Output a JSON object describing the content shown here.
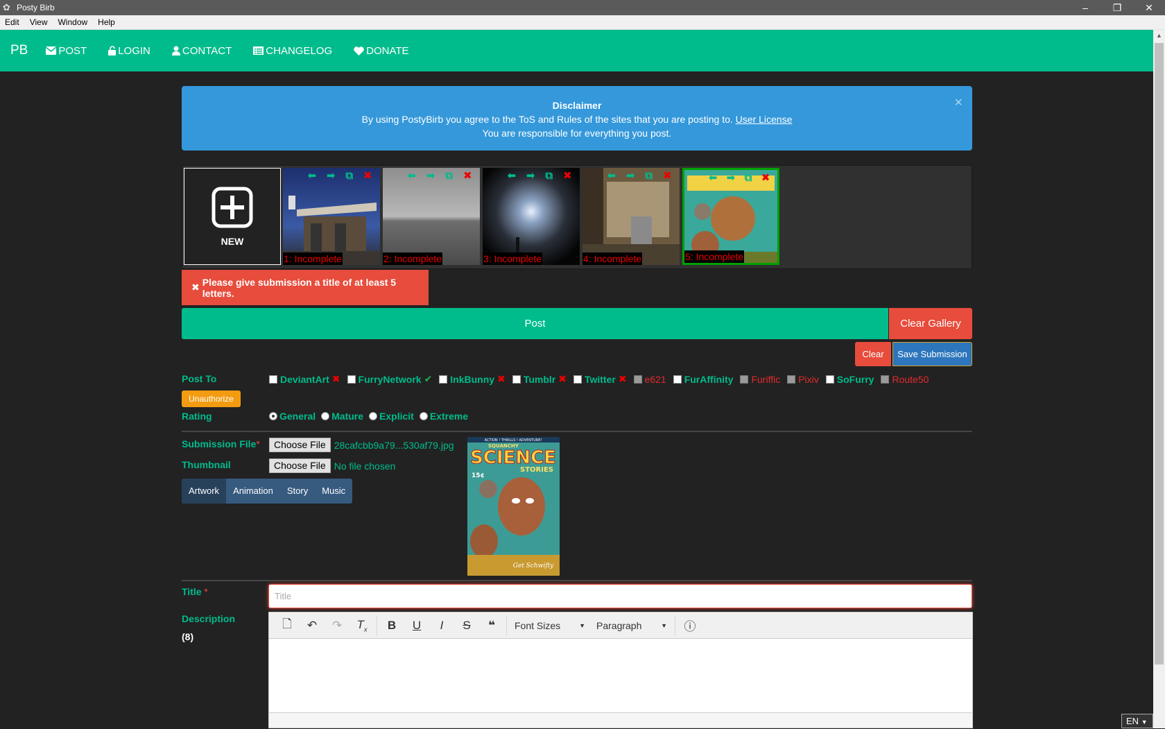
{
  "window": {
    "title": "Posty Birb",
    "menu": [
      "Edit",
      "View",
      "Window",
      "Help"
    ]
  },
  "nav": {
    "brand": "PB",
    "items": [
      {
        "label": "POST",
        "icon": "envelope-icon"
      },
      {
        "label": "LOGIN",
        "icon": "unlock-icon"
      },
      {
        "label": "CONTACT",
        "icon": "user-icon"
      },
      {
        "label": "CHANGELOG",
        "icon": "list-icon"
      },
      {
        "label": "DONATE",
        "icon": "heart-icon"
      }
    ]
  },
  "disclaimer": {
    "title": "Disclaimer",
    "line1": "By using PostyBirb you agree to the ToS and Rules of the sites that you are posting to.",
    "link": "User License",
    "line2": "You are responsible for everything you post.",
    "close": "×"
  },
  "gallery": {
    "new_label": "NEW",
    "items": [
      {
        "status": "1: Incomplete"
      },
      {
        "status": "2: Incomplete"
      },
      {
        "status": "3: Incomplete"
      },
      {
        "status": "4: Incomplete"
      },
      {
        "status": "5: Incomplete"
      }
    ]
  },
  "alert": {
    "icon": "✖",
    "text": "Please give submission a title of at least 5 letters."
  },
  "actions": {
    "post": "Post",
    "clear_gallery": "Clear Gallery",
    "clear": "Clear",
    "save": "Save Submission"
  },
  "post_to": {
    "label": "Post To",
    "unauthorize": "Unauthorize",
    "sites": [
      {
        "name": "DeviantArt",
        "state": "x"
      },
      {
        "name": "FurryNetwork",
        "state": "check"
      },
      {
        "name": "InkBunny",
        "state": "x"
      },
      {
        "name": "Tumblr",
        "state": "x"
      },
      {
        "name": "Twitter",
        "state": "x"
      },
      {
        "name": "e621",
        "state": "disabled"
      },
      {
        "name": "FurAffinity",
        "state": "ok"
      },
      {
        "name": "Furiffic",
        "state": "disabled"
      },
      {
        "name": "Pixiv",
        "state": "disabled"
      },
      {
        "name": "SoFurry",
        "state": "ok"
      },
      {
        "name": "Route50",
        "state": "disabled"
      }
    ]
  },
  "rating": {
    "label": "Rating",
    "options": [
      "General",
      "Mature",
      "Explicit",
      "Extreme"
    ],
    "selected": "General"
  },
  "files": {
    "submission_label": "Submission File",
    "required_mark": "*",
    "choose": "Choose File",
    "submission_value": "28cafcbb9a79...530af79.jpg",
    "thumbnail_label": "Thumbnail",
    "thumbnail_value": "No file chosen"
  },
  "type_tabs": [
    "Artwork",
    "Animation",
    "Story",
    "Music"
  ],
  "preview": {
    "line1": "ACTION ! THRILLS ! ADVENTURE!",
    "brand": "SQUANCHY",
    "science": "SCIENCE",
    "stories": "STORIES",
    "price": "15¢",
    "tagline": "Get Schwifty"
  },
  "title_field": {
    "label": "Title",
    "required_mark": "*",
    "placeholder": "Title"
  },
  "description": {
    "label": "Description",
    "count": "(8)",
    "font_sizes": "Font Sizes",
    "paragraph": "Paragraph"
  },
  "lang": "EN",
  "colors": {
    "accent": "#00bc8c",
    "danger": "#e74c3c",
    "info": "#3498db",
    "warning": "#f39c12",
    "primary": "#375a7f"
  }
}
